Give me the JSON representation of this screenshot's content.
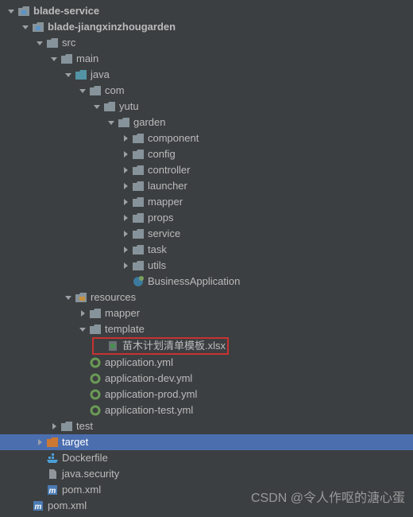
{
  "tree": [
    {
      "depth": 0,
      "arrow": "down",
      "icon": "module",
      "label": "blade-service",
      "bold": true
    },
    {
      "depth": 1,
      "arrow": "down",
      "icon": "module",
      "label": "blade-jiangxinzhougarden",
      "bold": true
    },
    {
      "depth": 2,
      "arrow": "down",
      "icon": "folder",
      "label": "src"
    },
    {
      "depth": 3,
      "arrow": "down",
      "icon": "folder",
      "label": "main"
    },
    {
      "depth": 4,
      "arrow": "down",
      "icon": "folder",
      "label": "java",
      "color": "#5294a5"
    },
    {
      "depth": 5,
      "arrow": "down",
      "icon": "folder",
      "label": "com"
    },
    {
      "depth": 6,
      "arrow": "down",
      "icon": "folder",
      "label": "yutu"
    },
    {
      "depth": 7,
      "arrow": "down",
      "icon": "folder",
      "label": "garden"
    },
    {
      "depth": 8,
      "arrow": "right",
      "icon": "folder",
      "label": "component"
    },
    {
      "depth": 8,
      "arrow": "right",
      "icon": "folder",
      "label": "config"
    },
    {
      "depth": 8,
      "arrow": "right",
      "icon": "folder",
      "label": "controller"
    },
    {
      "depth": 8,
      "arrow": "right",
      "icon": "folder",
      "label": "launcher"
    },
    {
      "depth": 8,
      "arrow": "right",
      "icon": "folder",
      "label": "mapper"
    },
    {
      "depth": 8,
      "arrow": "right",
      "icon": "folder",
      "label": "props"
    },
    {
      "depth": 8,
      "arrow": "right",
      "icon": "folder",
      "label": "service"
    },
    {
      "depth": 8,
      "arrow": "right",
      "icon": "folder",
      "label": "task"
    },
    {
      "depth": 8,
      "arrow": "right",
      "icon": "folder",
      "label": "utils"
    },
    {
      "depth": 8,
      "arrow": "none",
      "icon": "class",
      "label": "BusinessApplication"
    },
    {
      "depth": 4,
      "arrow": "down",
      "icon": "resources",
      "label": "resources"
    },
    {
      "depth": 5,
      "arrow": "right",
      "icon": "folder",
      "label": "mapper"
    },
    {
      "depth": 5,
      "arrow": "down",
      "icon": "folder",
      "label": "template"
    },
    {
      "depth": 6,
      "arrow": "none",
      "icon": "xlsx",
      "label": "苗木计划清单模板.xlsx",
      "highlighted": true
    },
    {
      "depth": 5,
      "arrow": "none",
      "icon": "yml",
      "label": "application.yml"
    },
    {
      "depth": 5,
      "arrow": "none",
      "icon": "yml",
      "label": "application-dev.yml"
    },
    {
      "depth": 5,
      "arrow": "none",
      "icon": "yml",
      "label": "application-prod.yml"
    },
    {
      "depth": 5,
      "arrow": "none",
      "icon": "yml",
      "label": "application-test.yml"
    },
    {
      "depth": 3,
      "arrow": "right",
      "icon": "folder",
      "label": "test"
    },
    {
      "depth": 2,
      "arrow": "right",
      "icon": "target",
      "label": "target",
      "selected": true,
      "color": "#d28a3a"
    },
    {
      "depth": 2,
      "arrow": "none",
      "icon": "docker",
      "label": "Dockerfile"
    },
    {
      "depth": 2,
      "arrow": "none",
      "icon": "file",
      "label": "java.security"
    },
    {
      "depth": 2,
      "arrow": "none",
      "icon": "maven",
      "label": "pom.xml"
    },
    {
      "depth": 1,
      "arrow": "none",
      "icon": "maven",
      "label": "pom.xml"
    }
  ],
  "watermark": "CSDN @令人作呕的溏心蛋"
}
